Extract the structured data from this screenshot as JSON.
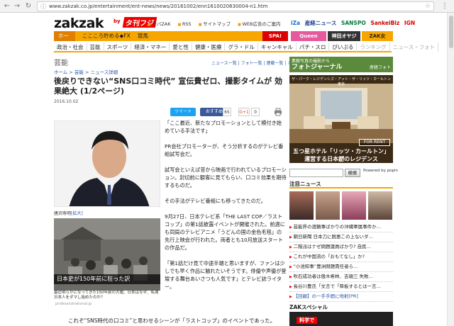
{
  "browser": {
    "url": "www.zakzak.co.jp/entertainment/ent-news/news/20161002/enn1610020830004-n1.htm"
  },
  "header": {
    "logo": "zakzak",
    "logo_by": "by",
    "logo_fuji": "タ刊フジ",
    "top_links": [
      "モバZAK",
      "RSS",
      "サイトマップ",
      "WEB広告のご案内"
    ],
    "partners": [
      "iZa",
      "産経ニュース",
      "SANSPO",
      "SankeiBiz",
      "IGN"
    ],
    "nav1": [
      "ホーム",
      "ここころ貯める◆FX",
      "競馬"
    ],
    "ad_strips": [
      "SPA!",
      "Queen",
      "神田オヤジ",
      "ZAK女"
    ],
    "nav2": [
      "政治・社会",
      "芸能",
      "スポーツ",
      "経済・マネー",
      "愛と性",
      "健康・医療",
      "グラ・ドル",
      "キャンキャル",
      "パチ・スロ",
      "ぴいぷる",
      "ランキング",
      "ニュース・フォト"
    ]
  },
  "article": {
    "section": "芸能",
    "section_links": "ニュース一覧 | フォト一覧 | 連載一覧 | ミスキャンパス",
    "breadcrumb": "ホーム > 芸能 > ニュース詳細",
    "title": "後戻りできない“SNS口コミ時代” 宣伝費ゼロ、撮影タイムが 効果絶大 (1/2ページ)",
    "date": "2016.10.02",
    "share": {
      "tweet": "ツイート",
      "facebook": "おすすめ",
      "facebook_count": "65",
      "gplus": "G+1",
      "gplus_count": "0"
    },
    "photo_caption": "唐沢寿明",
    "photo_caption_link": "[拡大]",
    "ad": {
      "headline": "日本史が150年前に狂った訳",
      "text": "最近明らかになってきた150年前の大嘘。日本はなぜ、私達日本人をダマし始めたのか？",
      "source": "pridesandnational.jp"
    },
    "paragraphs": [
      "「ここ最近、新たなプロモーションとして模付き始めている手法です」",
      "PR会社プロモーターが、そう分析するのがテレビ番組試写会だ。",
      "試写会といえば昔から映画で行われているプロモーション。封切前に観客に見てもらい、口コミ効果を期待するものだ。",
      "その手法がテレビ番組にも移ってきたのだ。",
      "9月27日、日本テレビ系「THE LAST COP／ラストコップ」の第1話披露イベントが開催された。前週にも同局のテレビアニメ「うどんの国の金色毛毯」の先行上映会が行われた。両者とも10月放送スタートの作品だ。",
      "「第1話だけ見て中途半端と思いますが、ファンは少しでも早く作品に触れたいそうです。俳優や声優が登壇する舞台あいさつも人気です」とテレビ誌ライター。"
    ],
    "bottom_line": "これぞ“SNS時代の口コミ”と思わせるシーンが「ラストコップ」のイベントであった。"
  },
  "sidebar": {
    "ad1_small": "素敵写真の撮影から",
    "ad1_big": "フォトジャーナル",
    "ad1_sub": "産経フォト",
    "ad2_top": "ザ・パーク・レジデンシズ・アット・ザ・リッツ・カールトン東京",
    "ad2_cta": "FOR RENT",
    "ad2_line1": "五つ星ホテル「リッツ・カールトン」が",
    "ad2_line2": "運営する日本初のレジデンス",
    "search_button": "検索",
    "popin": "Powered by popin",
    "news_head": "注目ニュース",
    "news_items": [
      "芸能界の渡鶴事ばかりの沖縄軍属事件か…",
      "朝日新聞 日本刀に脱悪この上ないダ…",
      "二階派はナゼ問題議員ばかり? 自民…",
      "これが中国流の「おもてなし」か?",
      "“小池知事”豊洲問題責任者ら…",
      "吹石成功者は傲木希林、吉親三 失敗…",
      "長谷川豊氏「文言で「降板するとは一言…",
      "【回顧】の一手手間に地射[PR]"
    ],
    "special_head": "ZAKスペシャル",
    "special_tag": "料学で"
  },
  "colors": {
    "brand_orange": "#f7a600",
    "link_blue": "#2a5aa8",
    "accent_red": "#e00000"
  }
}
